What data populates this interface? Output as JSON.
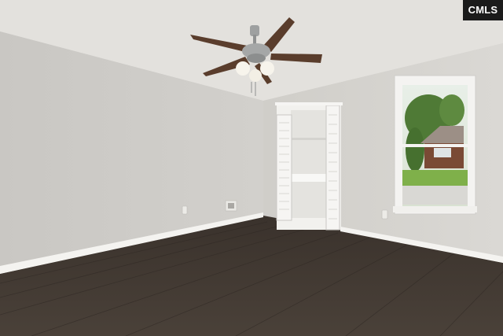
{
  "watermark": {
    "text": "CMLS"
  },
  "colors": {
    "ceiling": "#e3e1dd",
    "wall_left": "#cdcbc7",
    "wall_right": "#d6d4d0",
    "floor": "#3f3730",
    "baseboard": "#f4f3f0",
    "fan_blade": "#5a3d2c",
    "window_grass": "#7fb04a",
    "window_tree": "#4f7a36"
  },
  "icons": [
    "ceiling-fan",
    "closet-bifold-door",
    "window",
    "floor-vent",
    "outlet"
  ]
}
